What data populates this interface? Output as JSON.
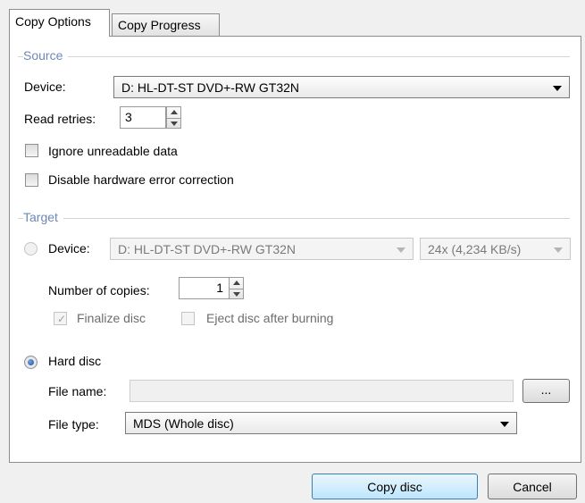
{
  "tabs": [
    {
      "label": "Copy Options",
      "active": true
    },
    {
      "label": "Copy Progress",
      "active": false
    }
  ],
  "source": {
    "group_label": "Source",
    "device_label": "Device:",
    "device_value": "D: HL-DT-ST DVD+-RW GT32N",
    "read_retries_label": "Read retries:",
    "read_retries_value": "3",
    "ignore_unreadable_label": "Ignore unreadable data",
    "ignore_unreadable_checked": false,
    "disable_hw_ecc_label": "Disable hardware error correction",
    "disable_hw_ecc_checked": false
  },
  "target": {
    "group_label": "Target",
    "device_label": "Device:",
    "device_value": "D: HL-DT-ST DVD+-RW GT32N",
    "speed_value": "24x (4,234 KB/s)",
    "copies_label": "Number of copies:",
    "copies_value": "1",
    "finalize_label": "Finalize disc",
    "finalize_checked": true,
    "eject_label": "Eject disc after burning",
    "eject_checked": false,
    "hard_disc_label": "Hard disc",
    "hard_disc_selected": true,
    "device_selected": false,
    "file_name_label": "File name:",
    "file_name_value": "",
    "browse_label": "...",
    "file_type_label": "File type:",
    "file_type_value": "MDS (Whole disc)"
  },
  "buttons": {
    "copy_disc": "Copy disc",
    "cancel": "Cancel"
  },
  "colors": {
    "group_header": "#6d88b5",
    "default_button": "#bee6fd"
  }
}
